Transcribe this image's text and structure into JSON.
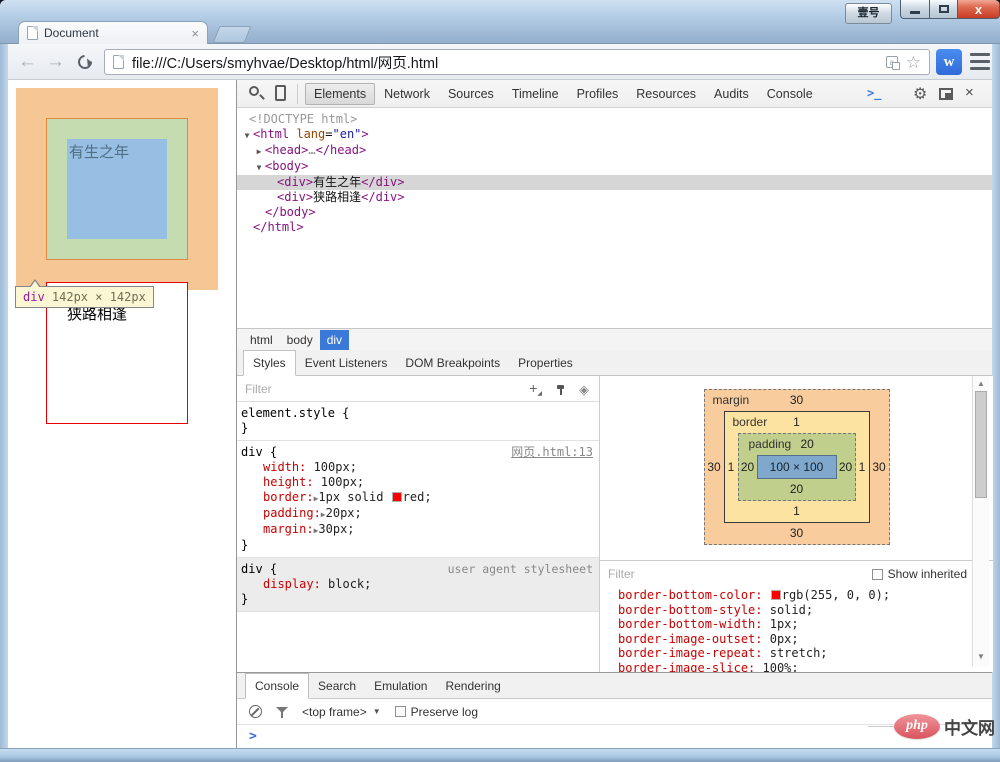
{
  "window": {
    "tab_title": "Document",
    "tab_close": "×",
    "profile_button": "壹号",
    "close_glyph": "x",
    "url": "file:///C:/Users/smyhvae/Desktop/html/网页.html",
    "w_badge": "w",
    "translate_glyph": "a"
  },
  "page": {
    "div1_text": "有生之年",
    "div2_text": "狭路相逢",
    "tooltip_tag": "div",
    "tooltip_size": " 142px × 142px"
  },
  "devtools": {
    "tabs": [
      "Elements",
      "Network",
      "Sources",
      "Timeline",
      "Profiles",
      "Resources",
      "Audits",
      "Console"
    ],
    "console_button": ">_",
    "gear_glyph": "⚙",
    "close_glyph": "×",
    "dom": {
      "doctype": "<!DOCTYPE html>",
      "arrow_open": "▼",
      "arrow_closed": "▶",
      "html_open": "<html ",
      "html_attr_name": "lang",
      "html_attr_eq": "=",
      "html_attr_value": "\"en\"",
      "html_open_end": ">",
      "head_open": "<head>",
      "head_ellipsis": "…",
      "head_close": "</head>",
      "body_open": "<body>",
      "div_open": "<div>",
      "div1_text": "有生之年",
      "div_close": "</div>",
      "div2_text": "狭路相逢",
      "body_close": "</body>",
      "html_close": "</html>"
    },
    "breadcrumb": [
      "html",
      "body",
      "div"
    ],
    "sidebar_tabs": [
      "Styles",
      "Event Listeners",
      "DOM Breakpoints",
      "Properties"
    ],
    "styles_pane": {
      "filter_placeholder": "Filter",
      "plus_icon": "+",
      "plus_caret": "◢",
      "state_icon": "◈",
      "element_style": {
        "selector": "element.style {",
        "close": "}"
      },
      "rule1": {
        "selector": "div {",
        "close": "}",
        "source_link": "网页.html:13",
        "props": [
          {
            "name": "width:",
            "value": " 100px;"
          },
          {
            "name": "height:",
            "value": " 100px;"
          },
          {
            "name": "border:",
            "expand": "▶",
            "value": "1px solid ",
            "swatch": "#ff0000",
            "value2": "red;"
          },
          {
            "name": "padding:",
            "expand": "▶",
            "value": "20px;"
          },
          {
            "name": "margin:",
            "expand": "▶",
            "value": "30px;"
          }
        ]
      },
      "rule2": {
        "selector": "div {",
        "close": "}",
        "source_label": "user agent stylesheet",
        "props": [
          {
            "name": "display:",
            "value": " block;"
          }
        ]
      }
    },
    "metrics": {
      "margin_label": "margin",
      "margin_top": "30",
      "margin_bottom": "30",
      "margin_left": "30",
      "margin_right": "30",
      "border_label": "border",
      "border_top": "1",
      "border_bottom": "1",
      "border_left": "1",
      "border_right": "1",
      "padding_label": "padding",
      "padding_top": "20",
      "padding_bottom": "20",
      "padding_left": "20",
      "padding_right": "20",
      "content": "100 × 100"
    },
    "computed": {
      "filter_placeholder": "Filter",
      "show_inherited": "Show inherited",
      "props": [
        {
          "name": "border-bottom-color:",
          "swatch": "#ff0000",
          "value": "rgb(255, 0, 0);"
        },
        {
          "name": "border-bottom-style:",
          "value": " solid;"
        },
        {
          "name": "border-bottom-width:",
          "value": " 1px;"
        },
        {
          "name": "border-image-outset:",
          "value": " 0px;"
        },
        {
          "name": "border-image-repeat:",
          "value": " stretch;"
        },
        {
          "name": "border-image-slice:",
          "value": " 100%;"
        }
      ]
    },
    "drawer": {
      "tabs": [
        "Console",
        "Search",
        "Emulation",
        "Rendering"
      ],
      "frame_select": "<top frame>",
      "frame_caret": "▼",
      "preserve_log": "Preserve log",
      "prompt": ">"
    },
    "scroll_up": "▲",
    "scroll_down": "▼"
  },
  "watermark": {
    "badge": "php",
    "text": "中文网"
  }
}
